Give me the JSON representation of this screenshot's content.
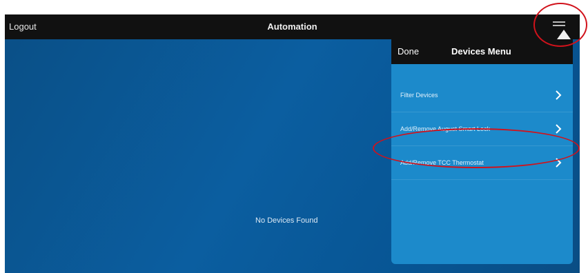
{
  "topbar": {
    "logout_label": "Logout",
    "title": "Automation",
    "menu_icon": "hamburger-menu-icon"
  },
  "main": {
    "empty_message": "No Devices Found"
  },
  "devices_menu": {
    "done_label": "Done",
    "title": "Devices Menu",
    "items": [
      {
        "label": "Filter Devices",
        "icon": "chevron-right-icon"
      },
      {
        "label": "Add/Remove August Smart Lock",
        "icon": "chevron-right-icon"
      },
      {
        "label": "Add/Remove TCC Thermostat",
        "icon": "chevron-right-icon"
      }
    ]
  },
  "colors": {
    "background_blue": "#0b5ea0",
    "menu_blue": "#1c8acb",
    "bar_black": "#111111",
    "highlight_red": "#d1121b"
  }
}
